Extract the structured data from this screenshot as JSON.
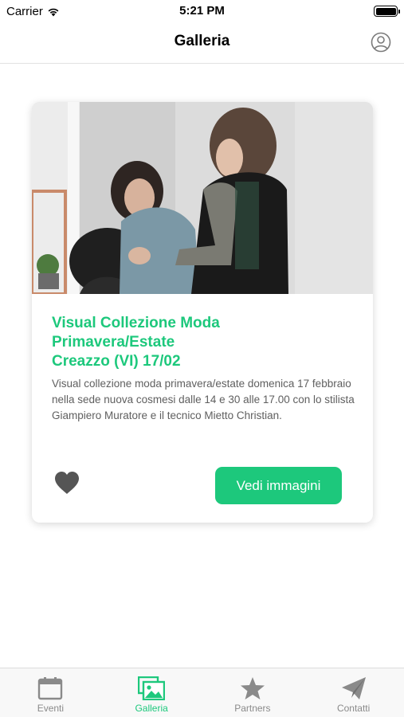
{
  "status_bar": {
    "carrier": "Carrier",
    "time": "5:21 PM"
  },
  "nav": {
    "title": "Galleria",
    "profile_icon": "user-circle-icon"
  },
  "card": {
    "title_lines": [
      "Visual Collezione Moda",
      "Primavera/Estate",
      "Creazzo (VI) 17/02"
    ],
    "description": "Visual collezione moda primavera/estate domenica 17 febbraio nella sede nuova cosmesi dalle 14 e 30 alle 17.00 con lo stilista Giampiero Muratore e il tecnico Mietto Christian.",
    "button_label": "Vedi immagini",
    "favorite_icon": "heart-icon"
  },
  "tabs": [
    {
      "label": "Eventi",
      "icon": "calendar-icon",
      "active": false
    },
    {
      "label": "Galleria",
      "icon": "gallery-icon",
      "active": true
    },
    {
      "label": "Partners",
      "icon": "star-icon",
      "active": false
    },
    {
      "label": "Contatti",
      "icon": "paper-plane-icon",
      "active": false
    }
  ],
  "colors": {
    "accent": "#1dc87c",
    "inactive": "#8a8a8a",
    "heart": "#555555"
  }
}
